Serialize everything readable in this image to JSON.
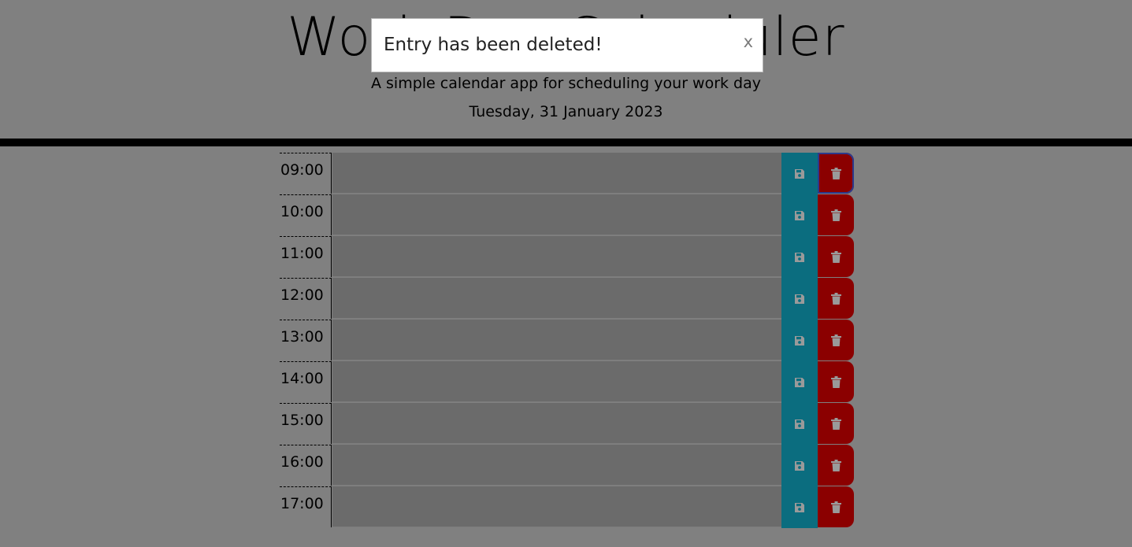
{
  "header": {
    "title": "Work Day Scheduler",
    "lead": "A simple calendar app for scheduling your work day",
    "current_day": "Tuesday, 31 January 2023"
  },
  "modal": {
    "message": "Entry has been deleted!",
    "close_label": "x"
  },
  "schedule": {
    "rows": [
      {
        "hour": "09:00",
        "text": ""
      },
      {
        "hour": "10:00",
        "text": ""
      },
      {
        "hour": "11:00",
        "text": ""
      },
      {
        "hour": "12:00",
        "text": ""
      },
      {
        "hour": "13:00",
        "text": ""
      },
      {
        "hour": "14:00",
        "text": ""
      },
      {
        "hour": "15:00",
        "text": ""
      },
      {
        "hour": "16:00",
        "text": ""
      },
      {
        "hour": "17:00",
        "text": ""
      }
    ]
  },
  "icons": {
    "save": "save-icon",
    "delete": "trash-icon"
  },
  "colors": {
    "background": "#808080",
    "textarea": "#6b6b6b",
    "save": "#0b6d7f",
    "delete": "#8b0000",
    "rule": "#000000"
  }
}
